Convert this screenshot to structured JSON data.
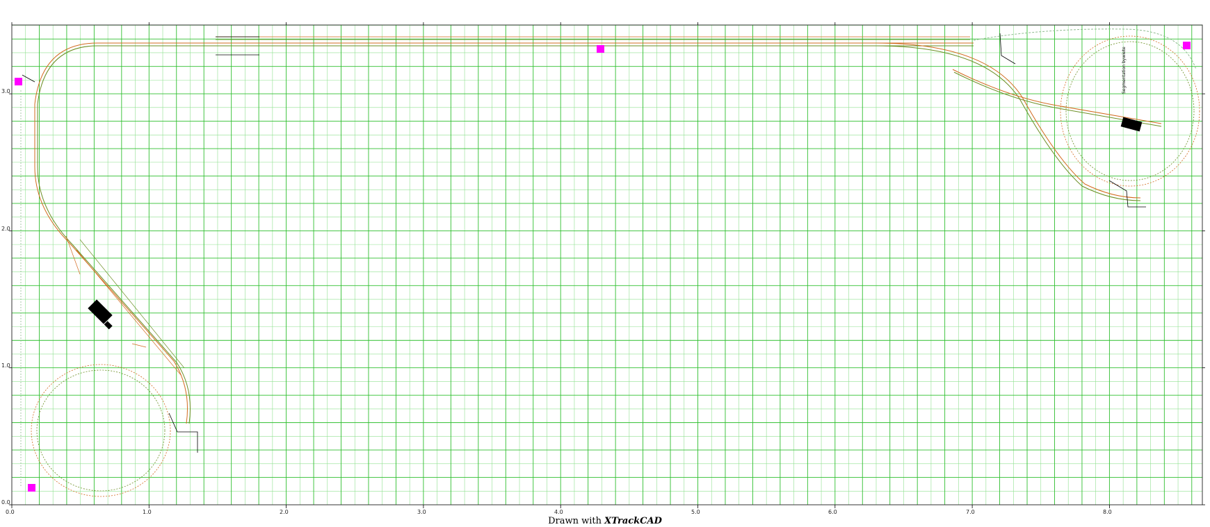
{
  "footer": {
    "prefix": "Drawn with ",
    "brand": "XTrackCAD"
  },
  "x_ticks": [
    "0.0",
    "1.0",
    "2.0",
    "3.0",
    "4.0",
    "5.0",
    "6.0",
    "7.0",
    "8.0"
  ],
  "y_ticks": [
    "0.0",
    "1.0",
    "2.0",
    "3.0"
  ],
  "vertical_label": "Segmentation bywiete",
  "colors": {
    "grid_major": "#2fbf2f",
    "grid_minor": "#8fe08f",
    "rail": "#d2691e",
    "tie": "#6b8e23",
    "marker": "#ff00ff",
    "structure": "#000000"
  },
  "markers": [
    {
      "name": "marker-top-left"
    },
    {
      "name": "marker-top-center"
    },
    {
      "name": "marker-top-right"
    },
    {
      "name": "marker-bottom-left"
    }
  ]
}
